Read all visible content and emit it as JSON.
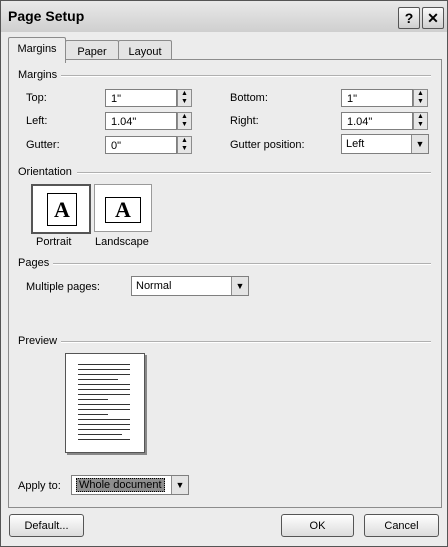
{
  "window": {
    "title": "Page Setup",
    "help_glyph": "?",
    "close_glyph": "✕"
  },
  "tabs": [
    {
      "label": "Margins"
    },
    {
      "label": "Paper"
    },
    {
      "label": "Layout"
    }
  ],
  "margins": {
    "heading": "Margins",
    "top": {
      "label": "Top:",
      "value": "1\""
    },
    "left": {
      "label": "Left:",
      "value": "1.04\""
    },
    "gutter": {
      "label": "Gutter:",
      "value": "0\""
    },
    "bottom": {
      "label": "Bottom:",
      "value": "1\""
    },
    "right": {
      "label": "Right:",
      "value": "1.04\""
    },
    "gutter_position": {
      "label": "Gutter position:",
      "value": "Left"
    }
  },
  "orientation": {
    "heading": "Orientation",
    "portrait": {
      "label": "Portrait",
      "glyph": "A"
    },
    "landscape": {
      "label": "Landscape",
      "glyph": "A"
    }
  },
  "pages": {
    "heading": "Pages",
    "multiple_pages_label": "Multiple pages:",
    "multiple_pages_value": "Normal"
  },
  "preview": {
    "heading": "Preview"
  },
  "apply_to": {
    "label": "Apply to:",
    "value": "Whole document"
  },
  "buttons": {
    "default": "Default...",
    "ok": "OK",
    "cancel": "Cancel"
  },
  "icons": {
    "spin": "spin-arrows-icon",
    "dropdown": "chevron-down-icon"
  }
}
